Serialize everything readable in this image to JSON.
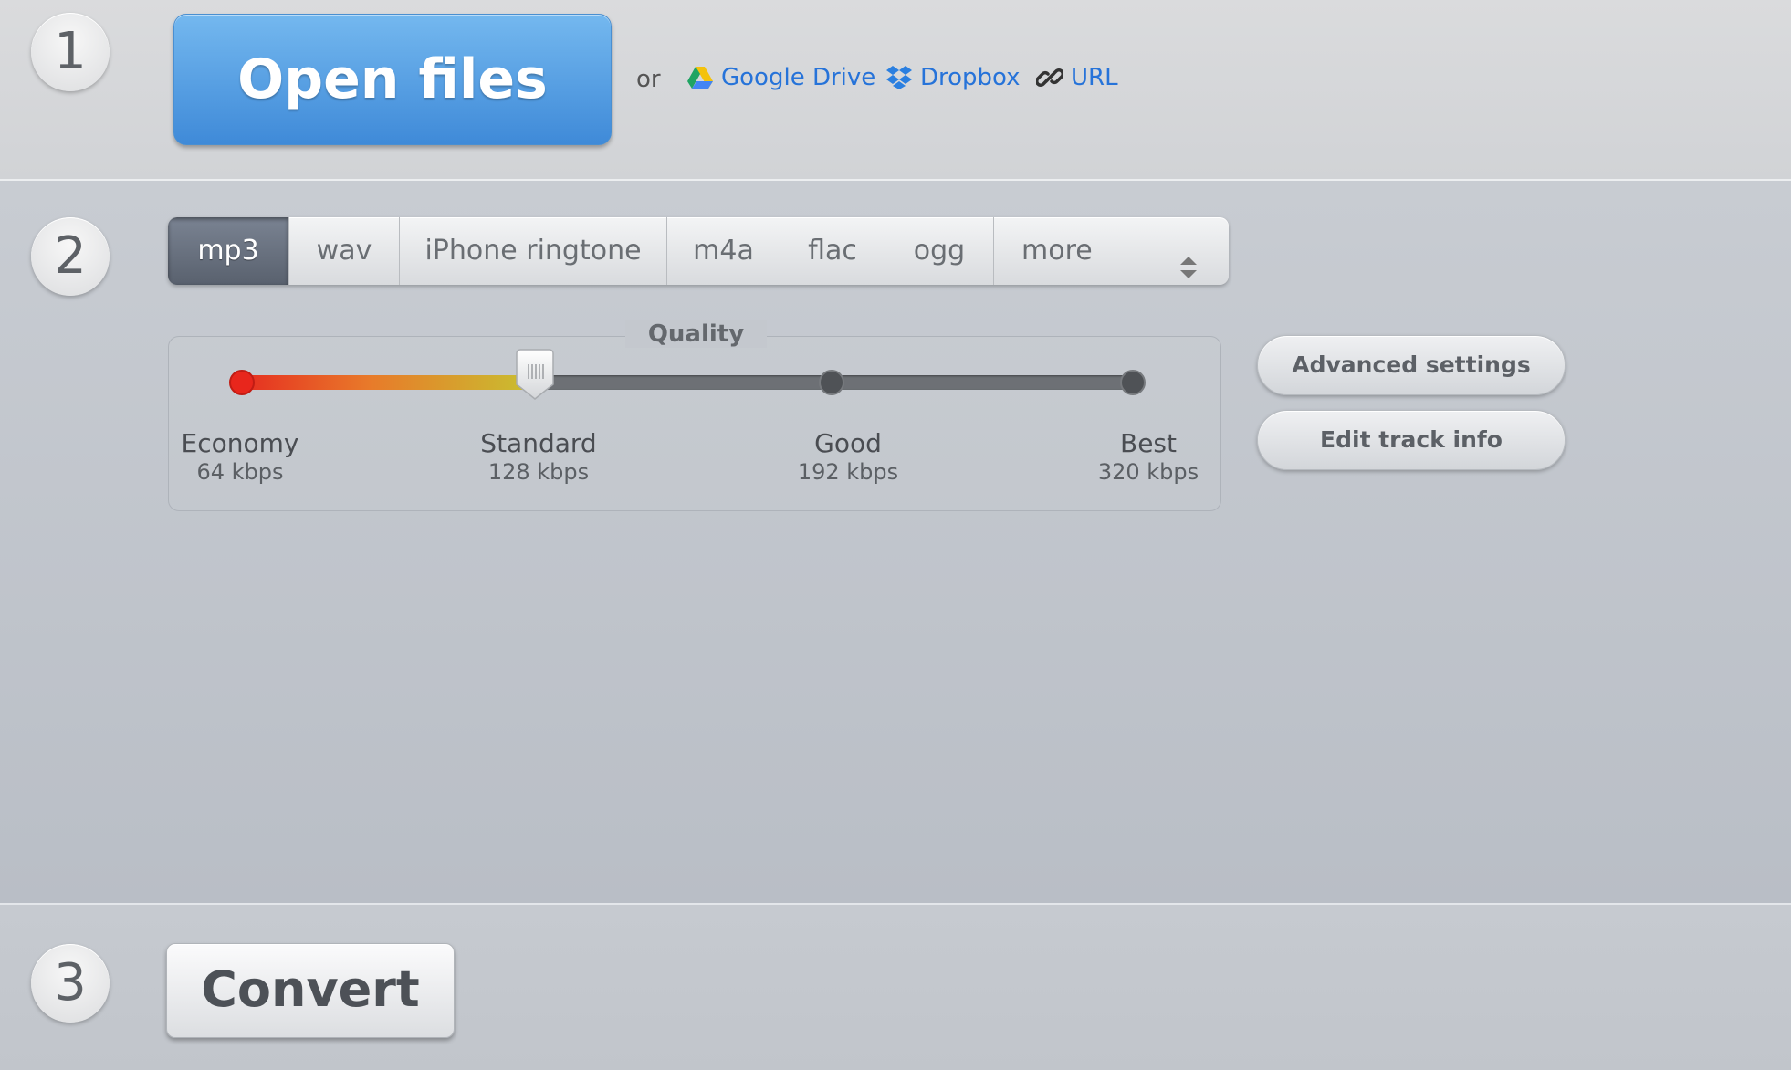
{
  "step1": {
    "number": "1",
    "open_files_label": "Open files",
    "or_text": "or",
    "sources": [
      {
        "label": "Google Drive",
        "icon": "google-drive-icon"
      },
      {
        "label": "Dropbox",
        "icon": "dropbox-icon"
      },
      {
        "label": "URL",
        "icon": "link-icon"
      }
    ]
  },
  "step2": {
    "number": "2",
    "formats": [
      "mp3",
      "wav",
      "iPhone ringtone",
      "m4a",
      "flac",
      "ogg",
      "more"
    ],
    "selected_format": "mp3",
    "quality": {
      "title": "Quality",
      "levels": [
        {
          "label": "Economy",
          "bitrate": "64 kbps"
        },
        {
          "label": "Standard",
          "bitrate": "128 kbps"
        },
        {
          "label": "Good",
          "bitrate": "192 kbps"
        },
        {
          "label": "Best",
          "bitrate": "320 kbps"
        }
      ],
      "selected_index": 1
    },
    "advanced_settings_label": "Advanced settings",
    "edit_track_info_label": "Edit track info"
  },
  "step3": {
    "number": "3",
    "convert_label": "Convert"
  },
  "colors": {
    "accent_blue": "#3f8ad8",
    "link_blue": "#2673d9",
    "quality_low": "#e62a20",
    "quality_mid": "#c8c030"
  }
}
